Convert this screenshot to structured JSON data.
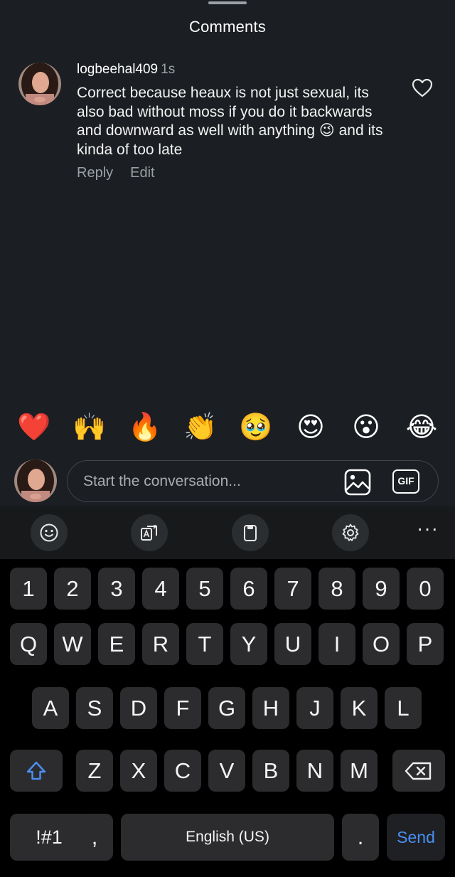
{
  "sheet": {
    "title": "Comments"
  },
  "comment": {
    "username": "logbeehal409",
    "timestamp": "1s",
    "text": "Correct because heaux is not just sexual, its also bad without moss if you do it backwards and downward as well with anything 😉 and its kinda of too late",
    "reply_label": "Reply",
    "edit_label": "Edit",
    "like_icon": "heart-outline-icon"
  },
  "reactions": [
    "❤️",
    "🙌",
    "🔥",
    "👏",
    "🥹",
    "😍",
    "😮",
    "😂"
  ],
  "composer": {
    "placeholder": "Start the conversation...",
    "image_icon": "image-icon",
    "gif_label": "GIF"
  },
  "keyboard_toolbar": {
    "icons": [
      "emoji-icon",
      "translate-icon",
      "clipboard-icon",
      "settings-icon",
      "more-icon"
    ],
    "more_label": "···"
  },
  "keyboard": {
    "number_row": [
      "1",
      "2",
      "3",
      "4",
      "5",
      "6",
      "7",
      "8",
      "9",
      "0"
    ],
    "row1": [
      "Q",
      "W",
      "E",
      "R",
      "T",
      "Y",
      "U",
      "I",
      "O",
      "P"
    ],
    "row2": [
      "A",
      "S",
      "D",
      "F",
      "G",
      "H",
      "J",
      "K",
      "L"
    ],
    "row3": [
      "Z",
      "X",
      "C",
      "V",
      "B",
      "N",
      "M"
    ],
    "symbols_label": "!#1",
    "comma_label": ",",
    "space_label": "English (US)",
    "period_label": ".",
    "send_label": "Send",
    "accent_color": "#4a90f2"
  }
}
